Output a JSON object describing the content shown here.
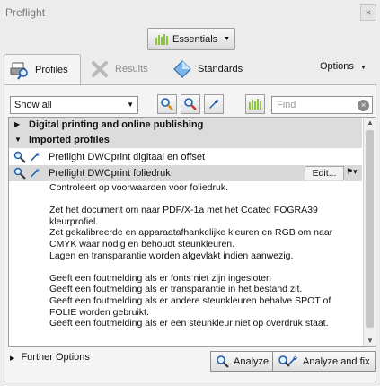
{
  "window": {
    "title": "Preflight",
    "close_glyph": "×"
  },
  "header": {
    "essentials_label": "Essentials"
  },
  "tabs": [
    {
      "label": "Profiles",
      "icon": "printer-magnifier-icon"
    },
    {
      "label": "Results",
      "icon": "results-x-icon"
    },
    {
      "label": "Standards",
      "icon": "standards-diamond-icon"
    }
  ],
  "options_label": "Options",
  "toolbar": {
    "filter_value": "Show all",
    "search_placeholder": "Find"
  },
  "groups": [
    {
      "label": "Digital printing and online publishing",
      "expanded": false
    },
    {
      "label": "Imported profiles",
      "expanded": true
    }
  ],
  "profiles": [
    {
      "label": "Preflight DWCprint digitaal en offset",
      "selected": false
    },
    {
      "label": "Preflight DWCprint foliedruk",
      "selected": true
    }
  ],
  "edit_label": "Edit...",
  "description": {
    "p1": "Controleert op voorwaarden voor foliedruk.",
    "p2": "Zet het document om naar PDF/X-1a met het Coated FOGRA39 kleurprofiel.",
    "p3": "Zet gekalibreerde en apparaatafhankelijke kleuren en RGB om naar CMYK waar nodig en behoudt steunkleuren.",
    "p4": "Lagen en transparantie worden afgevlakt indien aanwezig.",
    "p5": "Geeft een foutmelding als er fonts niet zijn ingesloten",
    "p6": "Geeft een foutmelding als er transparantie in het bestand zit.",
    "p7": "Geeft een foutmelding als er andere steunkleuren behalve SPOT of FOLIE worden gebruikt.",
    "p8": "Geeft een foutmelding als er een steunkleur niet op overdruk staat."
  },
  "footer": {
    "further_options": "Further Options",
    "analyze_label": "Analyze",
    "analyze_fix_label": "Analyze and fix"
  },
  "colors": {
    "accent_green": "#8cc63f",
    "selected_row": "#d9d9d9",
    "group_row": "#dcdcdc"
  }
}
